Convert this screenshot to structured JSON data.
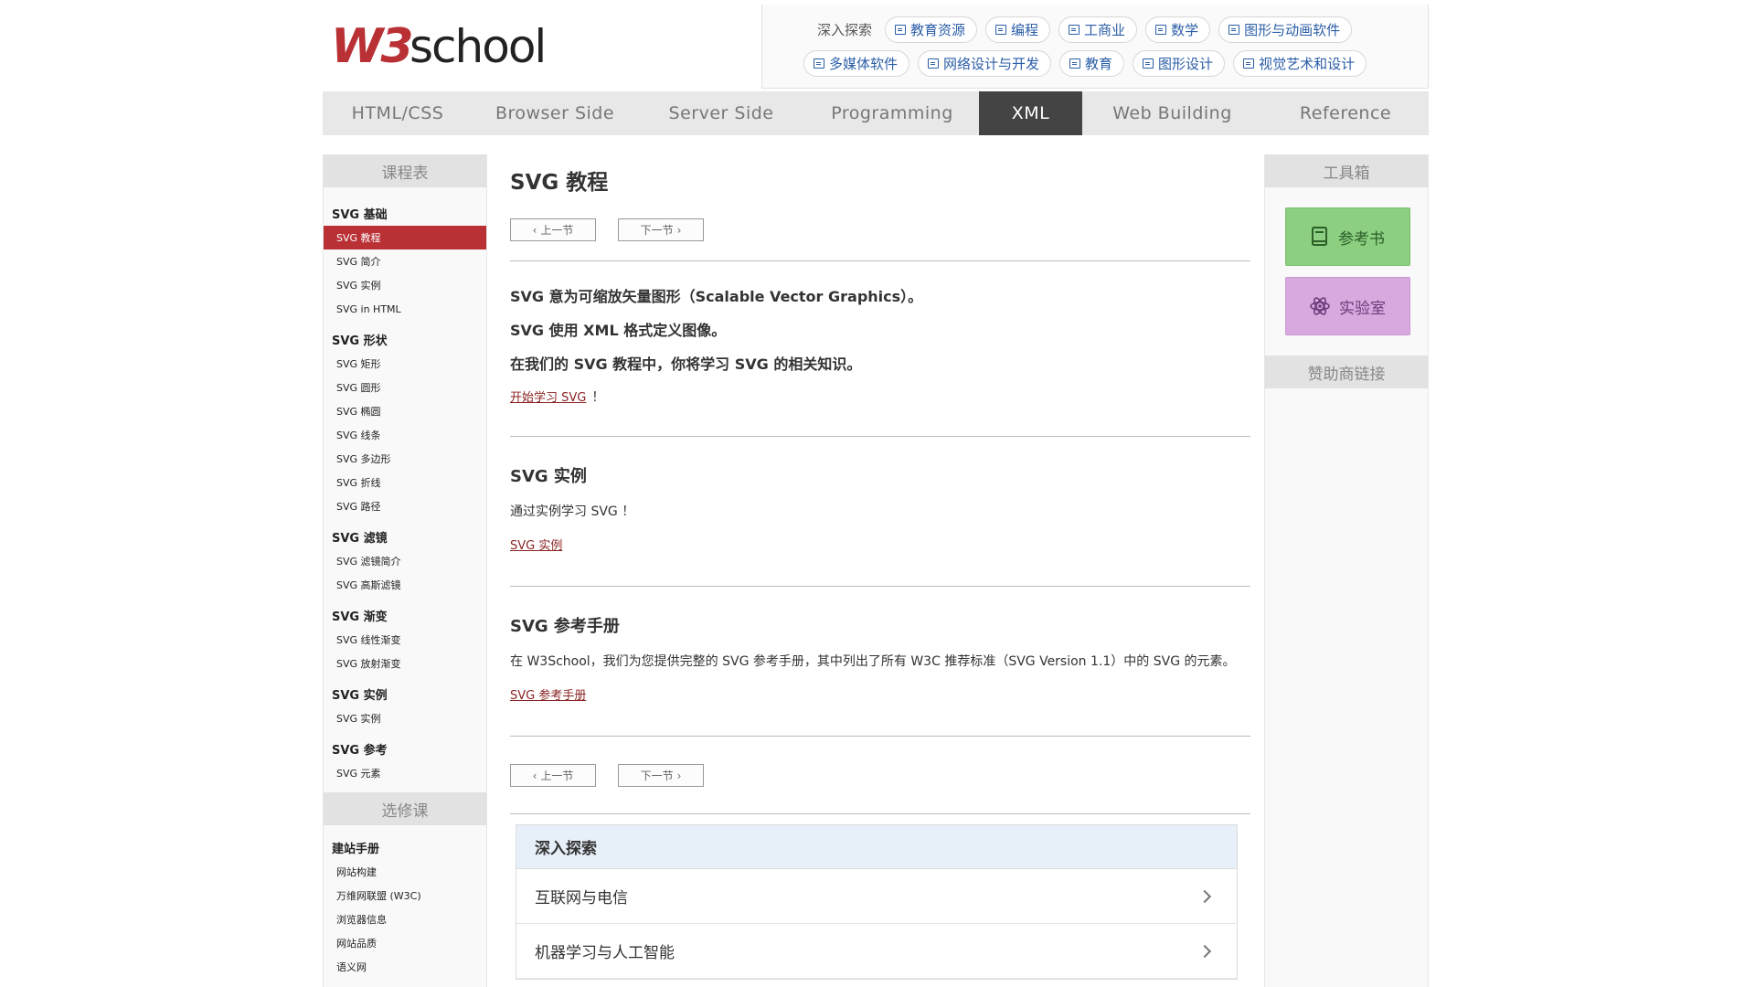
{
  "logo": {
    "text": "W3school"
  },
  "explore": {
    "label": "深入探索",
    "row1": [
      "教育资源",
      "编程",
      "工商业",
      "数学",
      "图形与动画软件"
    ],
    "row2": [
      "多媒体软件",
      "网络设计与开发",
      "教育",
      "图形设计",
      "视觉艺术和设计"
    ]
  },
  "nav": {
    "items": [
      {
        "label": "HTML/CSS",
        "width": 164
      },
      {
        "label": "Browser Side",
        "width": 180
      },
      {
        "label": "Server Side",
        "width": 184
      },
      {
        "label": "Programming",
        "width": 190
      },
      {
        "label": "XML",
        "width": 113,
        "active": true
      },
      {
        "label": "Web Building",
        "width": 197
      },
      {
        "label": "Reference",
        "width": 182
      }
    ]
  },
  "left": {
    "head1": "课程表",
    "sections": [
      {
        "title": "SVG 基础",
        "links": [
          "SVG 教程",
          "SVG 简介",
          "SVG 实例",
          "SVG in HTML"
        ]
      },
      {
        "title": "SVG 形状",
        "links": [
          "SVG 矩形",
          "SVG 圆形",
          "SVG 椭圆",
          "SVG 线条",
          "SVG 多边形",
          "SVG 折线",
          "SVG 路径"
        ]
      },
      {
        "title": "SVG 滤镜",
        "links": [
          "SVG 滤镜简介",
          "SVG 高斯滤镜"
        ]
      },
      {
        "title": "SVG 渐变",
        "links": [
          "SVG 线性渐变",
          "SVG 放射渐变"
        ]
      },
      {
        "title": "SVG 实例",
        "links": [
          "SVG 实例"
        ]
      },
      {
        "title": "SVG 参考",
        "links": [
          "SVG 元素"
        ]
      }
    ],
    "head2": "选修课",
    "elective": {
      "title": "建站手册",
      "links": [
        "网站构建",
        "万维网联盟 (W3C)",
        "浏览器信息",
        "网站品质",
        "语义网"
      ]
    }
  },
  "main": {
    "title": "SVG 教程",
    "prev": "上一节",
    "next": "下一节",
    "intro": [
      "SVG 意为可缩放矢量图形（Scalable Vector Graphics）。",
      "SVG 使用 XML 格式定义图像。",
      "在我们的 SVG 教程中，你将学习 SVG 的相关知识。"
    ],
    "start_link": "开始学习 SVG",
    "start_suffix": "！",
    "ex_title": "SVG 实例",
    "ex_text": "通过实例学习 SVG ！",
    "ex_link": "SVG 实例",
    "ref_title": "SVG 参考手册",
    "ref_text": "在 W3School，我们为您提供完整的 SVG 参考手册，其中列出了所有 W3C 推荐标准（SVG Version 1.1）中的 SVG 的元素。",
    "ref_link": "SVG 参考手册",
    "panel_title": "深入探索",
    "panel_items": [
      "互联网与电信",
      "机器学习与人工智能"
    ]
  },
  "right": {
    "head1": "工具箱",
    "ref_btn": "参考书",
    "lab_btn": "实验室",
    "head2": "赞助商链接"
  },
  "colors": {
    "accent": "#b93035",
    "nav_active": "#444444",
    "link": "#8a2323"
  }
}
